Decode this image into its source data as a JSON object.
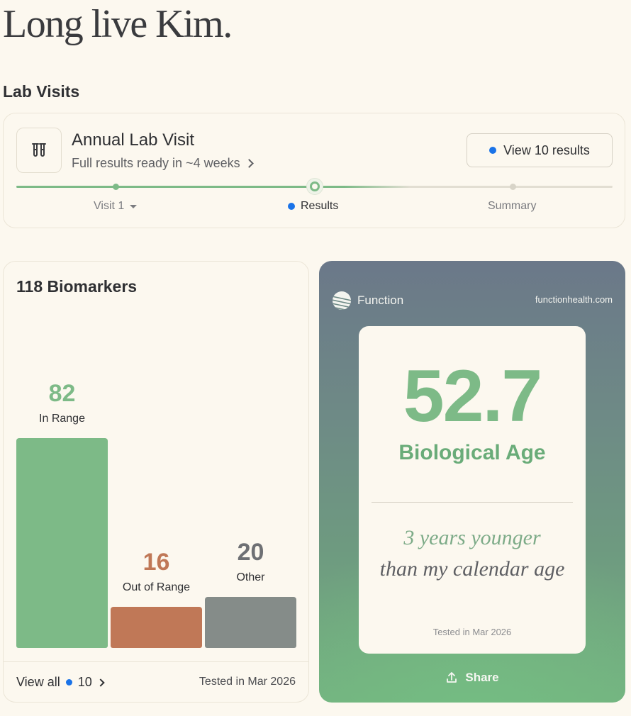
{
  "page": {
    "title": "Long live Kim."
  },
  "lab_visits": {
    "section_title": "Lab Visits",
    "visit": {
      "title": "Annual Lab Visit",
      "subtitle": "Full results ready in ~4 weeks",
      "view_button_label": "View 10 results",
      "steps": [
        {
          "label": "Visit 1",
          "state": "done"
        },
        {
          "label": "Results",
          "state": "current"
        },
        {
          "label": "Summary",
          "state": "todo"
        }
      ]
    }
  },
  "biomarkers": {
    "title": "118 Biomarkers",
    "bars": [
      {
        "value": "82",
        "label": "In Range",
        "color": "#7dba87",
        "level": 82
      },
      {
        "value": "16",
        "label": "Out of Range",
        "color": "#c07857",
        "level": 16
      },
      {
        "value": "20",
        "label": "Other",
        "color": "#858c89",
        "level": 20
      }
    ],
    "value_colors": [
      "#7dba87",
      "#c07857",
      "#6e7074"
    ],
    "view_all_label": "View all",
    "view_all_count": "10",
    "tested": "Tested in Mar 2026"
  },
  "share_card": {
    "brand": "Function",
    "url": "functionhealth.com",
    "age_value": "52.7",
    "age_label": "Biological Age",
    "line1": "3 years younger",
    "line2": "than my calendar age",
    "tested": "Tested in Mar 2026",
    "share_label": "Share"
  }
}
